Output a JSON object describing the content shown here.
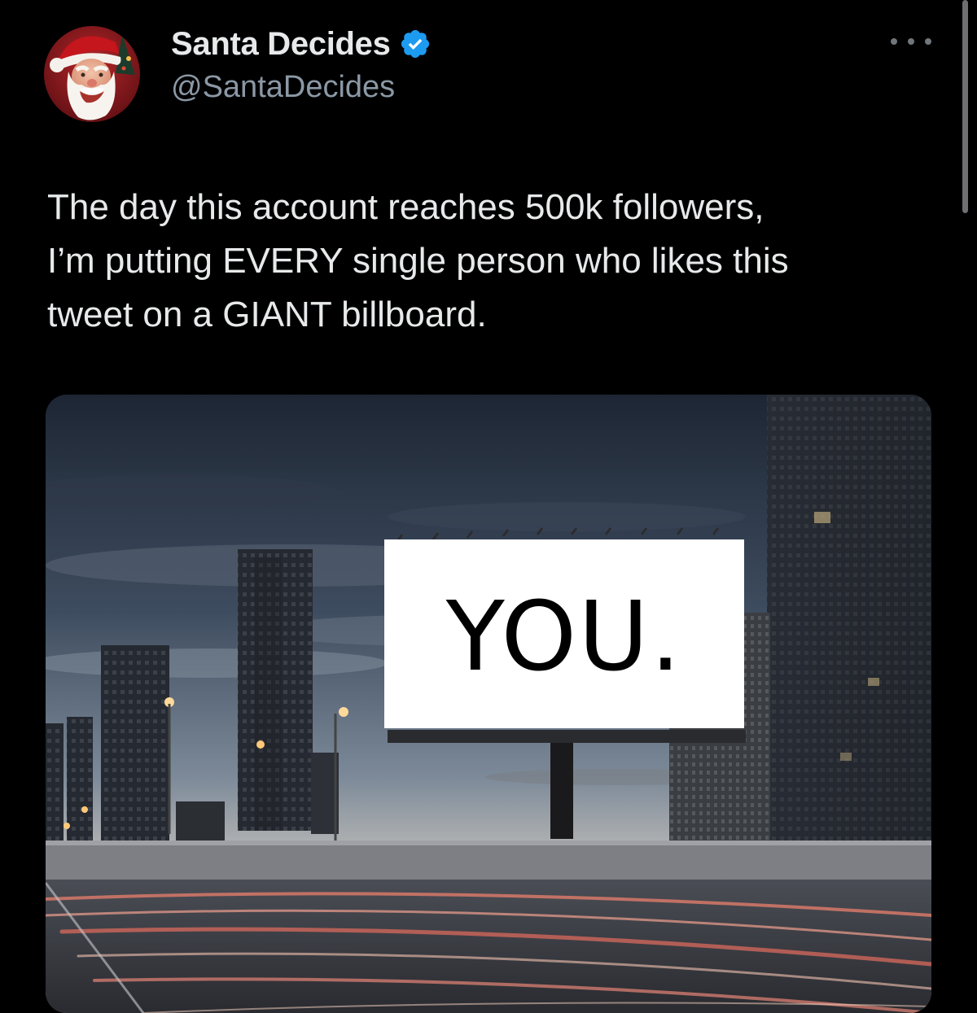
{
  "tweet": {
    "author": {
      "display_name": "Santa Decides",
      "handle": "@SantaDecides",
      "verified": true,
      "avatar_icon": "santa-claus-avatar"
    },
    "more_icon": "more-horizontal-icon",
    "text": "The day this account reaches 500k followers,\nI’m putting EVERY single person who likes this\ntweet on a GIANT billboard.",
    "media": {
      "billboard_text": "YOU."
    }
  },
  "colors": {
    "background": "#000000",
    "primary_text": "#e7e9ea",
    "secondary_text": "#8b98a5",
    "verified_blue": "#1d9bf0"
  }
}
